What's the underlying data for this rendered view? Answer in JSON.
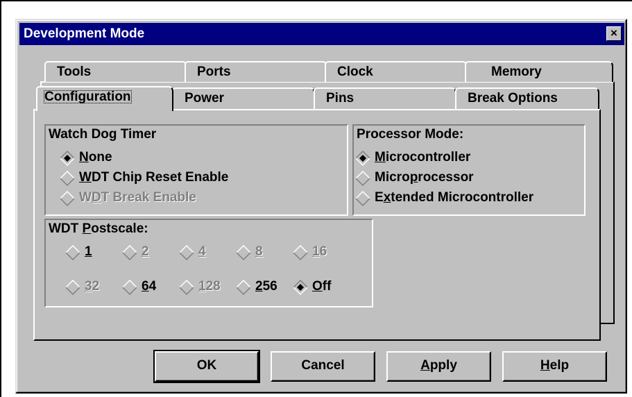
{
  "window": {
    "title": "Development Mode",
    "close_label": "×"
  },
  "tabs": {
    "back_row": [
      "Tools",
      "Ports",
      "Clock",
      "Memory"
    ],
    "front_row": [
      "Configuration",
      "Power",
      "Pins",
      "Break Options"
    ],
    "selected": "Configuration"
  },
  "watchdog": {
    "title": "Watch Dog Timer",
    "options": [
      {
        "pre": "",
        "key": "N",
        "post": "one",
        "selected": true,
        "enabled": true
      },
      {
        "pre": "",
        "key": "W",
        "post": "DT Chip Reset Enable",
        "selected": false,
        "enabled": true
      },
      {
        "pre": "W",
        "key": "D",
        "post": "T Break Enable",
        "selected": false,
        "enabled": false
      }
    ]
  },
  "processor_mode": {
    "title": "Processor Mode:",
    "options": [
      {
        "pre": "",
        "key": "M",
        "post": "icrocontroller",
        "selected": true
      },
      {
        "pre": "Micro",
        "key": "p",
        "post": "rocessor",
        "selected": false
      },
      {
        "pre": "E",
        "key": "x",
        "post": "tended Microcontroller",
        "selected": false
      }
    ]
  },
  "postscale": {
    "title_pre": "WDT ",
    "title_key": "P",
    "title_post": "ostscale:",
    "row1": [
      {
        "pre": "",
        "key": "1",
        "post": "",
        "enabled": true,
        "selected": false
      },
      {
        "pre": "",
        "key": "2",
        "post": "",
        "enabled": false,
        "selected": false
      },
      {
        "pre": "",
        "key": "4",
        "post": "",
        "enabled": false,
        "selected": false
      },
      {
        "pre": "",
        "key": "8",
        "post": "",
        "enabled": false,
        "selected": false
      },
      {
        "pre": "",
        "key": "1",
        "post": "6",
        "enabled": false,
        "selected": false
      }
    ],
    "row2": [
      {
        "pre": "",
        "key": "3",
        "post": "2",
        "enabled": false,
        "selected": false
      },
      {
        "pre": "",
        "key": "6",
        "post": "4",
        "enabled": true,
        "selected": false
      },
      {
        "pre": "",
        "key": "1",
        "post": "28",
        "enabled": false,
        "selected": false
      },
      {
        "pre": "",
        "key": "2",
        "post": "56",
        "enabled": true,
        "selected": false
      },
      {
        "pre": "",
        "key": "O",
        "post": "ff",
        "enabled": true,
        "selected": true
      }
    ]
  },
  "buttons": {
    "ok": "OK",
    "cancel": "Cancel",
    "apply_key": "A",
    "apply_rest": "pply",
    "help_key": "H",
    "help_rest": "elp"
  }
}
